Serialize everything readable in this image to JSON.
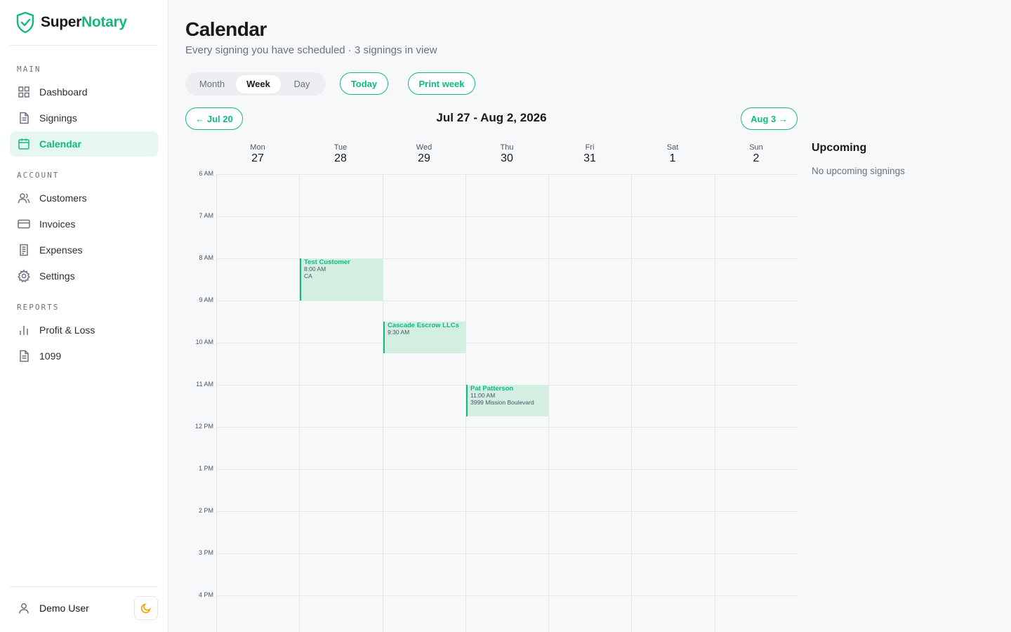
{
  "app": {
    "brand_part1": "Super",
    "brand_part2": "Notary"
  },
  "sidebar": {
    "sections": [
      {
        "label": "MAIN",
        "items": [
          {
            "label": "Dashboard",
            "icon": "dashboard-icon"
          },
          {
            "label": "Signings",
            "icon": "document-icon"
          },
          {
            "label": "Calendar",
            "icon": "calendar-icon",
            "active": true
          }
        ]
      },
      {
        "label": "ACCOUNT",
        "items": [
          {
            "label": "Customers",
            "icon": "users-icon"
          },
          {
            "label": "Invoices",
            "icon": "credit-card-icon"
          },
          {
            "label": "Expenses",
            "icon": "receipt-icon"
          },
          {
            "label": "Settings",
            "icon": "gear-icon"
          }
        ]
      },
      {
        "label": "REPORTS",
        "items": [
          {
            "label": "Profit & Loss",
            "icon": "bar-chart-icon"
          },
          {
            "label": "1099",
            "icon": "document-icon"
          }
        ]
      }
    ],
    "user_name": "Demo User"
  },
  "header": {
    "title": "Calendar",
    "subtitle": "Every signing you have scheduled · 3 signings in view"
  },
  "toolbar": {
    "views": [
      "Month",
      "Week",
      "Day"
    ],
    "selected_view": "Week",
    "today_label": "Today",
    "print_label": "Print week",
    "prev_label": "← Jul 20",
    "next_label": "Aug 3 →",
    "range_label": "Jul 27 - Aug 2, 2026"
  },
  "calendar": {
    "days": [
      {
        "name": "Mon",
        "date": "27"
      },
      {
        "name": "Tue",
        "date": "28"
      },
      {
        "name": "Wed",
        "date": "29"
      },
      {
        "name": "Thu",
        "date": "30"
      },
      {
        "name": "Fri",
        "date": "31"
      },
      {
        "name": "Sat",
        "date": "1"
      },
      {
        "name": "Sun",
        "date": "2"
      }
    ],
    "hours": [
      "6 AM",
      "7 AM",
      "8 AM",
      "9 AM",
      "10 AM",
      "11 AM",
      "12 PM",
      "1 PM",
      "2 PM",
      "3 PM",
      "4 PM"
    ],
    "events": [
      {
        "name": "Test Customer",
        "time": "8:00 AM",
        "detail": "CA"
      },
      {
        "name": "Cascade Escrow LLCs",
        "time": "9:30 AM",
        "detail": ""
      },
      {
        "name": "Pat Patterson",
        "time": "11:00 AM",
        "detail": "3999 Mission Boulevard"
      }
    ]
  },
  "upcoming": {
    "title": "Upcoming",
    "empty_text": "No upcoming signings"
  },
  "colors": {
    "accent": "#10b981",
    "event_bg": "#d3efe2",
    "active_nav_bg": "#e6f7ef"
  }
}
